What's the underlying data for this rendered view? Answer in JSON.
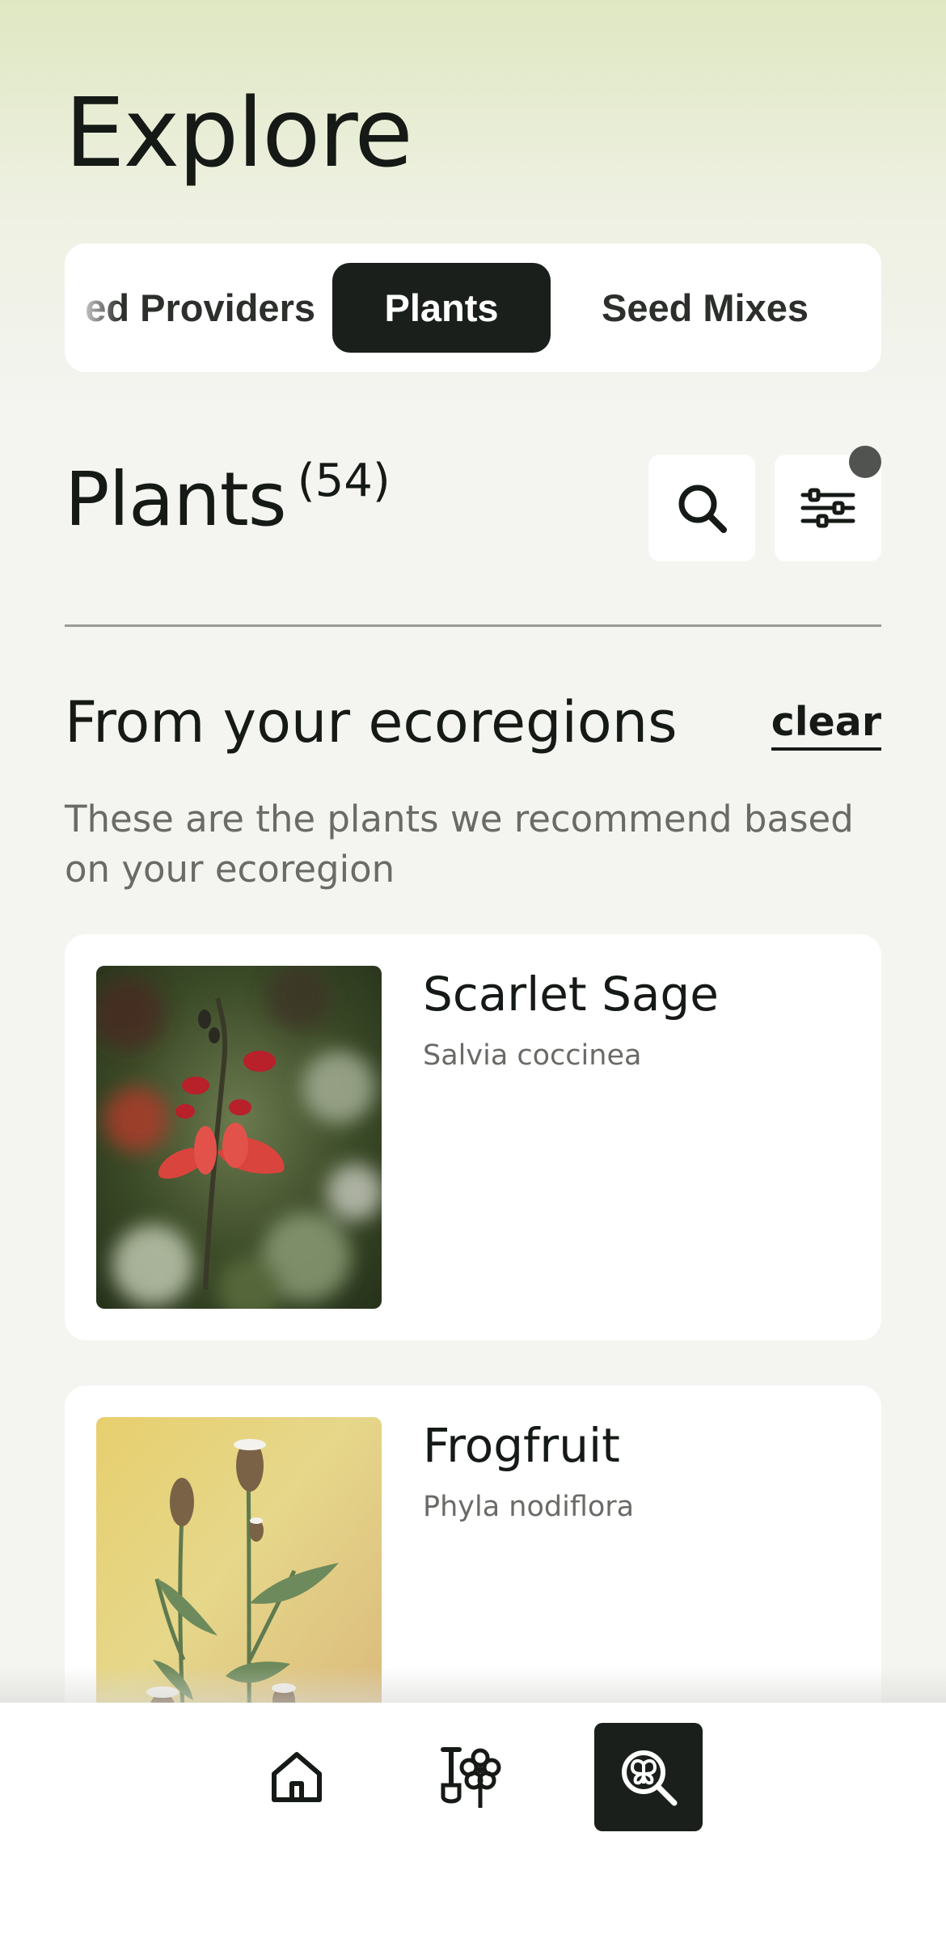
{
  "header": {
    "title": "Explore"
  },
  "segments": {
    "items": [
      {
        "label": "ed Providers",
        "state": "partial"
      },
      {
        "label": "Plants",
        "state": "active"
      },
      {
        "label": "Seed Mixes",
        "state": "inactive"
      }
    ]
  },
  "section": {
    "title": "Plants",
    "count": "(54)"
  },
  "toolbar": {
    "search_icon": "search-icon",
    "filter_icon": "sliders-icon",
    "filter_active": true
  },
  "ecoregion": {
    "title": "From your ecoregions",
    "clear_label": "clear",
    "description": "These are the plants we recommend based on your ecoregion"
  },
  "plants": [
    {
      "common_name": "Scarlet Sage",
      "scientific_name": "Salvia coccinea"
    },
    {
      "common_name": "Frogfruit",
      "scientific_name": "Phyla nodiflora"
    }
  ],
  "tabbar": {
    "items": [
      {
        "icon": "home-icon",
        "active": false
      },
      {
        "icon": "garden-tools-icon",
        "active": false
      },
      {
        "icon": "explore-search-icon",
        "active": true
      }
    ]
  },
  "colors": {
    "dark": "#1b1f1b",
    "accent_gradient_top": "#dfe7c2",
    "background": "#f4f4f1",
    "muted_text": "#6a6b67"
  }
}
